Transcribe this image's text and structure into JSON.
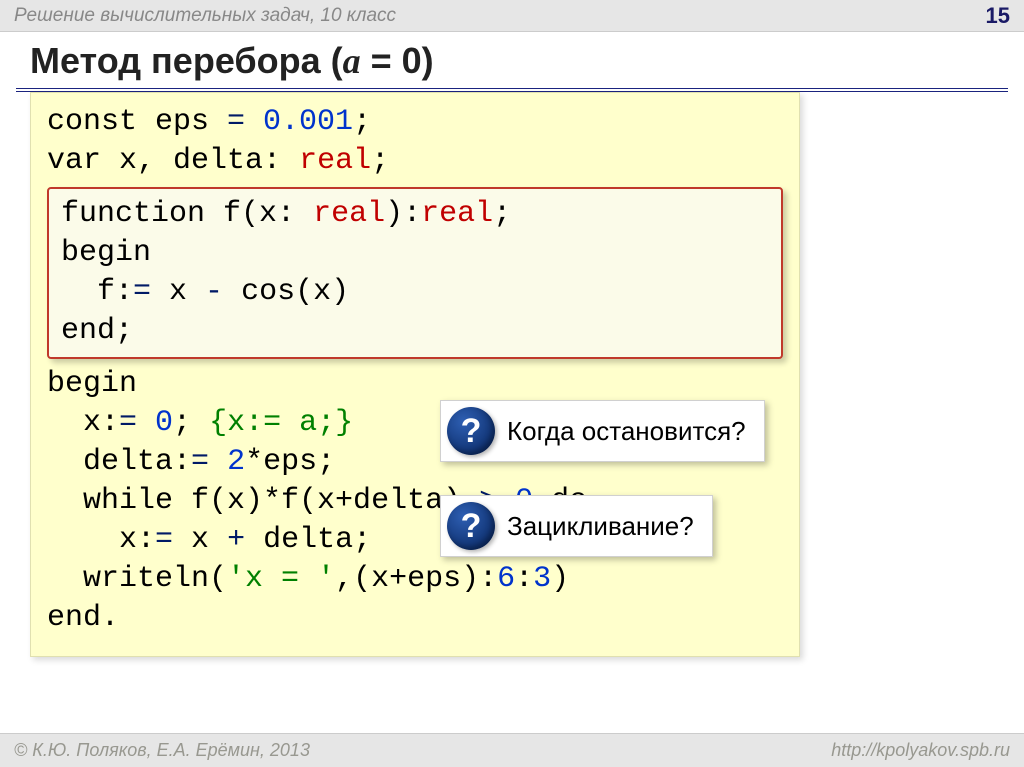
{
  "topbar": {
    "title": "Решение  вычислительных задач, 10 класс",
    "page": "15"
  },
  "title": {
    "prefix": "Метод перебора (",
    "var": "a",
    "eq": " = 0)",
    "full_plain": "Метод перебора (a = 0)"
  },
  "code": {
    "l1_a": "const eps",
    "l1_op": " = ",
    "l1_b": "0.001",
    "l1_c": ";",
    "l2_a": "var x, delta:",
    "l2_sp": " ",
    "l2_b": "real",
    "l2_c": ";",
    "fn1_a": "function",
    "fn1_b": " f(x:",
    "fn1_sp": " ",
    "fn1_c": "real",
    "fn1_d": "):",
    "fn1_e": "real",
    "fn1_f": ";",
    "fn2": "begin",
    "fn3_a": "  f:",
    "fn3_op": "=",
    "fn3_b": " x",
    "fn3_m": " - ",
    "fn3_c": "cos(x)",
    "fn4": "end;",
    "l3": "begin",
    "l4_a": "  x:",
    "l4_op": "=",
    "l4_v": " 0",
    "l4_s": "; ",
    "l4_c": "{x:",
    "l4_c_op": "=",
    "l4_c2": " a;}",
    "l5_a": "  delta:",
    "l5_op": "=",
    "l5_sp": " ",
    "l5_b": "2",
    "l5_c": "*eps;",
    "l6_a": "  while",
    "l6_b": " f(x)*f(x+delta)",
    "l6_gt": " > ",
    "l6_c": "0",
    "l6_d": " do",
    "l7_a": "    x:",
    "l7_op": "=",
    "l7_b": " x",
    "l7_p": " + ",
    "l7_c": "delta;",
    "l8_a": "  writeln(",
    "l8_b": "'x = '",
    "l8_c": ",(x+eps):",
    "l8_d": "6",
    "l8_e": ":",
    "l8_f": "3",
    "l8_g": ")",
    "l9": "end."
  },
  "callouts": {
    "q1": "Когда остановится?",
    "q2": "Зацикливание?",
    "icon_glyph": "?"
  },
  "footer": {
    "left": "© К.Ю. Поляков, Е.А. Ерёмин, 2013",
    "right": "http://kpolyakov.spb.ru"
  }
}
